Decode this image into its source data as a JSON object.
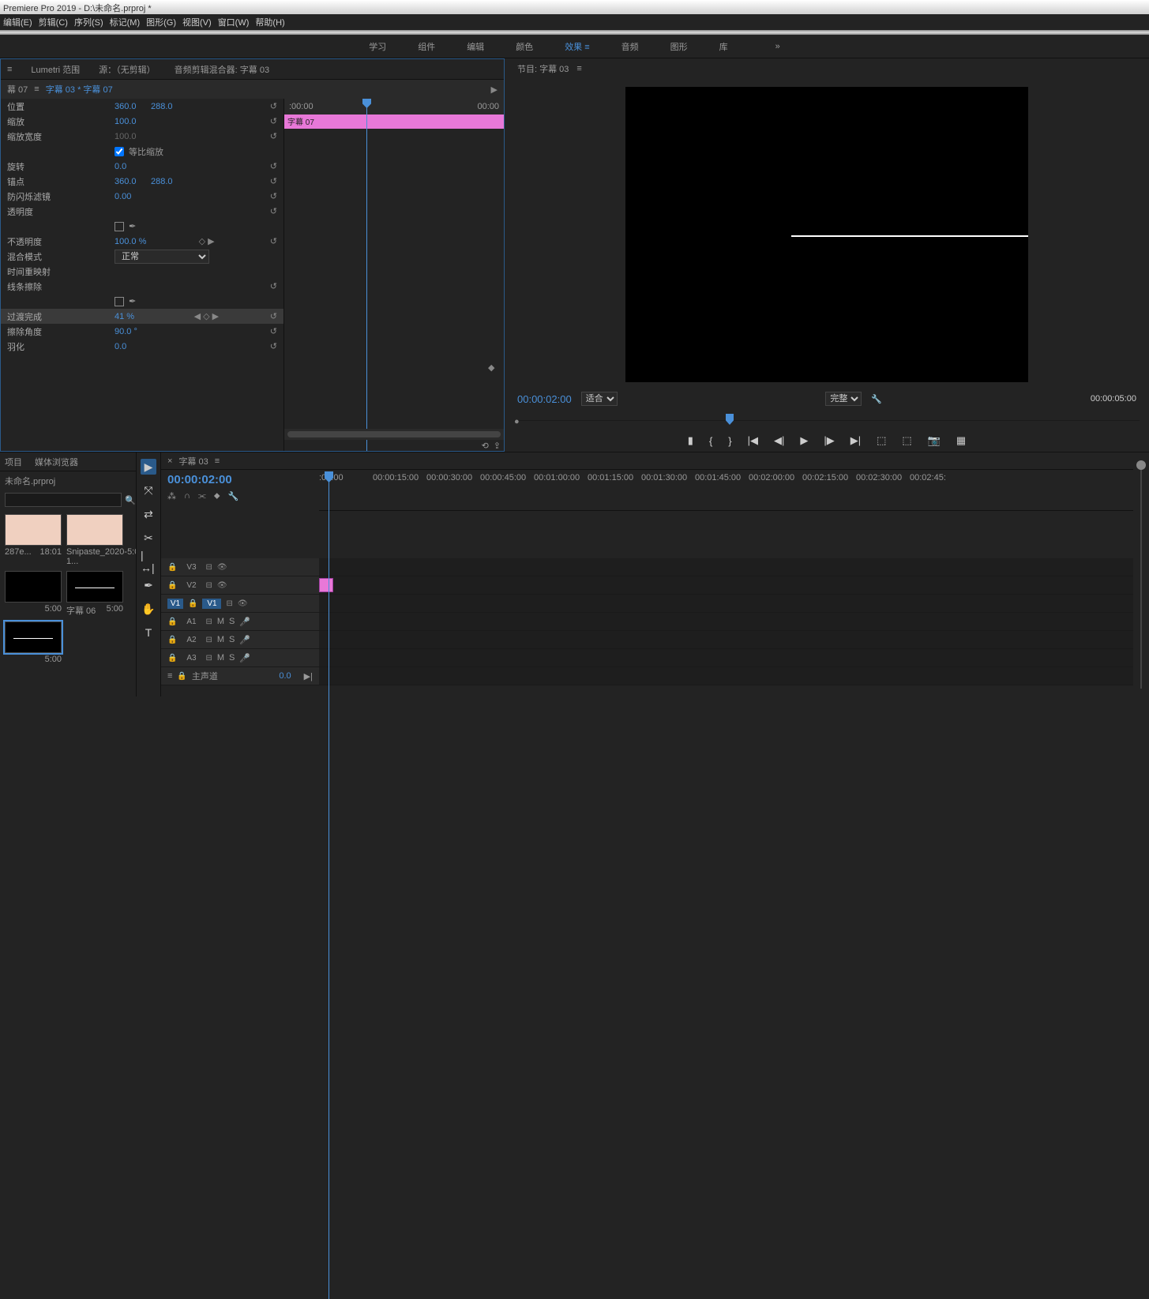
{
  "title": "Premiere Pro 2019 - D:\\未命名.prproj *",
  "menu": [
    "编辑(E)",
    "剪辑(C)",
    "序列(S)",
    "标记(M)",
    "图形(G)",
    "视图(V)",
    "窗口(W)",
    "帮助(H)"
  ],
  "workspaces": [
    "学习",
    "组件",
    "编辑",
    "颜色",
    "效果",
    "音频",
    "图形",
    "库"
  ],
  "panelTabs": [
    "Lumetri 范围",
    "源：（无剪辑）",
    "音频剪辑混合器: 字幕 03"
  ],
  "effectHeader": {
    "left": "幕 07",
    "clip": "字幕 03 * 字幕 07",
    "tlStart": ":00:00",
    "tlEnd": "00:00",
    "clipLabel": "字幕 07"
  },
  "props": [
    {
      "label": "位置",
      "v1": "360.0",
      "v2": "288.0",
      "reset": true
    },
    {
      "label": "缩放",
      "v1": "100.0",
      "reset": true
    },
    {
      "label": "缩放宽度",
      "v1": "100.0",
      "dim": true,
      "reset": true
    },
    {
      "label": "",
      "check": true,
      "checkLabel": "等比缩放"
    },
    {
      "label": "旋转",
      "v1": "0.0",
      "reset": true
    },
    {
      "label": "锚点",
      "v1": "360.0",
      "v2": "288.0",
      "reset": true
    },
    {
      "label": "防闪烁滤镜",
      "v1": "0.00",
      "reset": true
    },
    {
      "label": "透明度",
      "reset": true
    },
    {
      "label": "",
      "sq": true,
      "pen": true
    },
    {
      "label": "不透明度",
      "v1": "100.0 %",
      "kf": true,
      "reset": true
    },
    {
      "label": "混合模式",
      "select": "正常"
    },
    {
      "label": "时间重映射"
    },
    {
      "label": "线条擦除",
      "reset": true
    },
    {
      "label": "",
      "sq": true,
      "pen": true
    },
    {
      "label": "过渡完成",
      "v1": "41 %",
      "hilite": true,
      "kf": true,
      "nav": true,
      "reset": true
    },
    {
      "label": "擦除角度",
      "v1": "90.0 °",
      "reset": true
    },
    {
      "label": "羽化",
      "v1": "0.0",
      "reset": true
    }
  ],
  "program": {
    "title": "节目: 字幕 03",
    "time": "00:00:02:00",
    "fit": "适合",
    "quality": "完整",
    "duration": "00:00:05:00"
  },
  "project": {
    "tab1": "项目",
    "tab2": "媒体浏览器",
    "name": "未命名.prproj"
  },
  "bins": [
    {
      "name": "287e...",
      "dur": "18:01",
      "img": true
    },
    {
      "name": "Snipaste_2020-1...",
      "dur": "5:00",
      "img": true
    },
    {
      "name": "",
      "dur": "5:00"
    },
    {
      "name": "字幕 06",
      "dur": "5:00",
      "line": true
    },
    {
      "name": "",
      "dur": "5:00",
      "line": true,
      "sel": true
    }
  ],
  "timeline": {
    "tab": "字幕 03",
    "time": "00:00:02:00",
    "marks": [
      ":00:00",
      "00:00:15:00",
      "00:00:30:00",
      "00:00:45:00",
      "00:01:00:00",
      "00:01:15:00",
      "00:01:30:00",
      "00:01:45:00",
      "00:02:00:00",
      "00:02:15:00",
      "00:02:30:00",
      "00:02:45:"
    ],
    "tracks": [
      {
        "name": "V3",
        "type": "v"
      },
      {
        "name": "V2",
        "type": "v",
        "clip": true
      },
      {
        "name": "V1",
        "type": "v",
        "tgt": "V1",
        "on": true
      },
      {
        "name": "A1",
        "type": "a"
      },
      {
        "name": "A2",
        "type": "a"
      },
      {
        "name": "A3",
        "type": "a"
      }
    ],
    "master": "主声道",
    "masterVal": "0.0"
  }
}
